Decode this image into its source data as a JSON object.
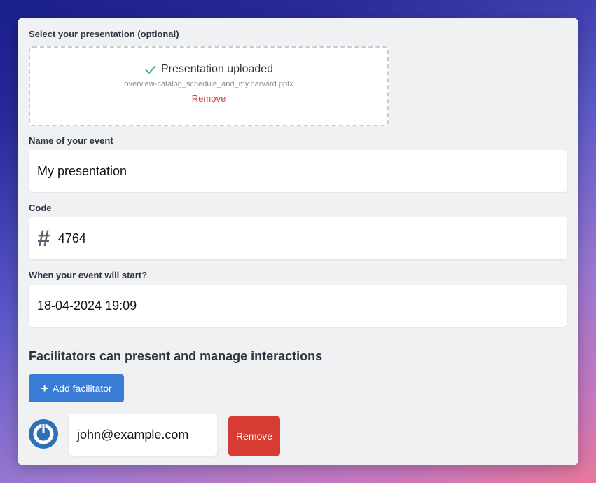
{
  "upload": {
    "label": "Select your presentation (optional)",
    "status": "Presentation uploaded",
    "filename": "overview-catalog_schedule_and_my.harvard.pptx",
    "remove_label": "Remove"
  },
  "event_name": {
    "label": "Name of your event",
    "value": "My presentation"
  },
  "code": {
    "label": "Code",
    "icon": "#",
    "value": "4764"
  },
  "start": {
    "label": "When your event will start?",
    "value": "18-04-2024 19:09"
  },
  "facilitators": {
    "heading": "Facilitators can present and manage interactions",
    "add_label": "Add facilitator",
    "items": [
      {
        "email": "john@example.com",
        "remove_label": "Remove"
      }
    ]
  },
  "colors": {
    "accent": "#3a7bd5",
    "danger": "#d83b32",
    "success": "#3bb273"
  }
}
